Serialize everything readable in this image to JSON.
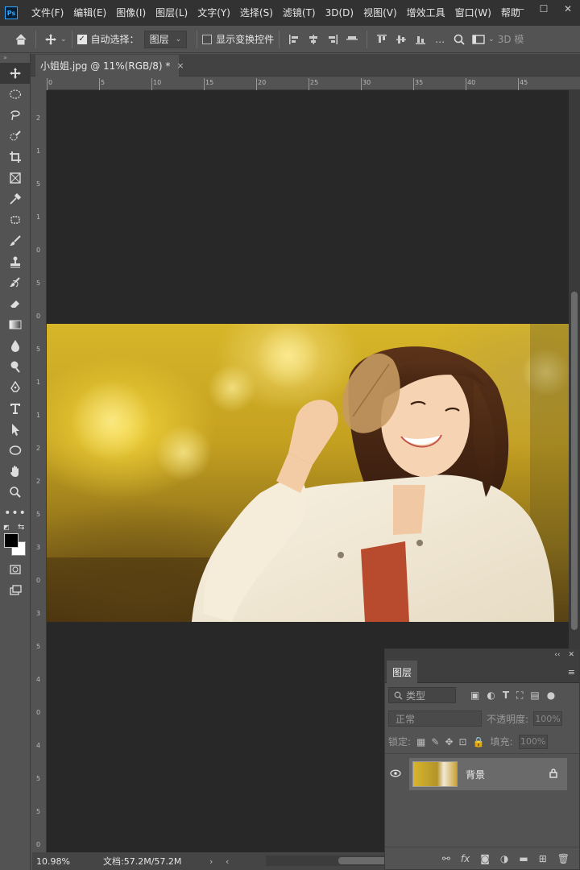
{
  "app": {
    "logo_text": "Ps"
  },
  "menu": [
    "文件(F)",
    "编辑(E)",
    "图像(I)",
    "图层(L)",
    "文字(Y)",
    "选择(S)",
    "滤镜(T)",
    "3D(D)",
    "视图(V)",
    "增效工具",
    "窗口(W)",
    "帮助"
  ],
  "window_controls": {
    "minimize": "—",
    "maximize": "☐",
    "close": "✕"
  },
  "options_bar": {
    "auto_select_label": "自动选择：",
    "auto_select_checked": true,
    "auto_select_target": "图层",
    "show_transform_label": "显示变换控件",
    "show_transform_checked": false,
    "mode_3d_label": "3D 模"
  },
  "document_tab": {
    "title": "小姐姐.jpg @ 11%(RGB/8) *",
    "close": "×"
  },
  "ruler": {
    "top_labels": [
      "0",
      "5",
      "10",
      "15",
      "20",
      "25",
      "30",
      "35",
      "40",
      "45"
    ],
    "left_labels": [
      "2",
      "1",
      "5",
      "1",
      "0",
      "5",
      "0",
      "5",
      "1",
      "1",
      "2",
      "2",
      "5",
      "3",
      "0",
      "3",
      "5",
      "4",
      "0",
      "4",
      "5",
      "5",
      "0"
    ]
  },
  "canvas": {
    "background_color": "#282828"
  },
  "statusbar": {
    "zoom": "10.98%",
    "doc_info": "文档:57.2M/57.2M"
  },
  "layers_panel": {
    "tab_label": "图层",
    "filter_placeholder": "类型",
    "blend_mode": "正常",
    "opacity_label": "不透明度:",
    "opacity_value": "100%",
    "lock_label": "锁定:",
    "fill_label": "填充:",
    "fill_value": "100%",
    "layers": [
      {
        "name": "背景",
        "visible": true,
        "locked": true
      }
    ]
  },
  "colors": {
    "accent": "#31a8ff",
    "panel_bg": "#535353",
    "menu_bg": "#323232"
  }
}
